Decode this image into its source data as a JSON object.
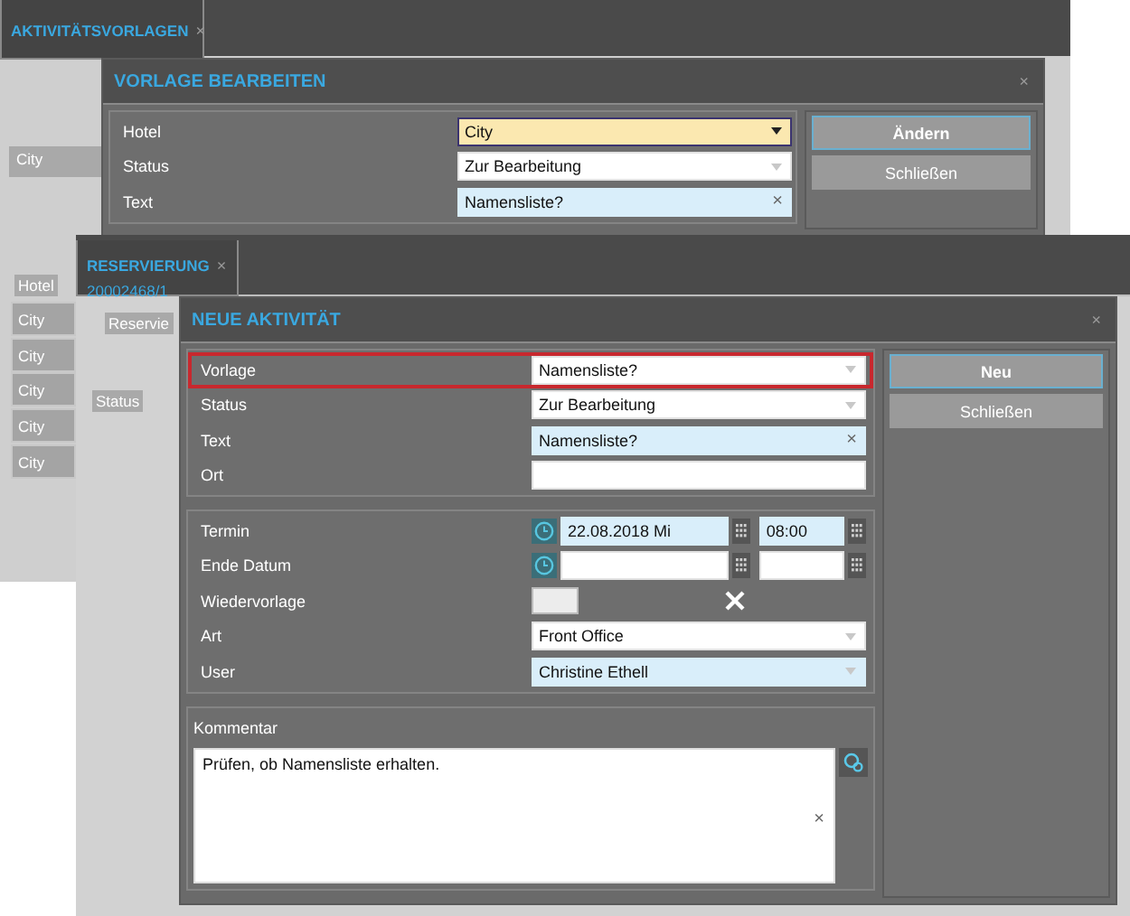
{
  "background_window": {
    "tab": {
      "label": "AKTIVITÄTSVORLAGEN",
      "close": "×"
    },
    "filter_field": {
      "value": "City"
    },
    "table": {
      "columns": [
        "Hotel"
      ],
      "rows": [
        "City",
        "City",
        "City",
        "City",
        "City"
      ]
    }
  },
  "edit_dialog": {
    "title": "VORLAGE BEARBEITEN",
    "close": "×",
    "fields": [
      {
        "label": "Hotel",
        "kind": "dropdown",
        "value": "City",
        "focused": true,
        "required": false
      },
      {
        "label": "Status",
        "kind": "dropdown",
        "value": "Zur Bearbeitung",
        "focused": false,
        "required": false
      },
      {
        "label": "Text",
        "kind": "text",
        "value": "Namensliste?",
        "clear": "×",
        "focused": false,
        "required": true
      }
    ],
    "buttons": [
      {
        "label": "Ändern",
        "primary": true
      },
      {
        "label": "Schließen",
        "primary": false
      }
    ]
  },
  "reservation_window": {
    "tab": {
      "label": "RESERVIERUNG",
      "close": "×",
      "subtitle": "20002468/1"
    },
    "inner_tab": "Reservie",
    "column": "Status"
  },
  "new_activity_dialog": {
    "title": "NEUE AKTIVITÄT",
    "close": "×",
    "sections": [
      {
        "fields": [
          {
            "label": "Vorlage",
            "kind": "dropdown",
            "value": "Namensliste?",
            "required": false,
            "error": true
          },
          {
            "label": "Status",
            "kind": "dropdown",
            "value": "Zur Bearbeitung",
            "required": false,
            "error": false
          },
          {
            "label": "Text",
            "kind": "text",
            "value": "Namensliste?",
            "clear": "×",
            "required": true,
            "error": false
          },
          {
            "label": "Ort",
            "kind": "text",
            "required": false,
            "error": false
          }
        ]
      },
      {
        "fields": [
          {
            "label": "Termin",
            "kind": "datetime",
            "date": "22.08.2018 Mi",
            "time": "08:00",
            "required": true,
            "error": false
          },
          {
            "label": "Ende Datum",
            "kind": "datetime",
            "required": false,
            "error": false
          },
          {
            "label": "Wiedervorlage",
            "kind": "toggle",
            "checked": false,
            "error": false
          },
          {
            "label": "Art",
            "kind": "dropdown",
            "value": "Front Office",
            "required": false,
            "error": false
          },
          {
            "label": "User",
            "kind": "dropdown",
            "value": "Christine Ethell",
            "required": true,
            "error": false
          }
        ]
      }
    ],
    "comment": {
      "label": "Kommentar",
      "value": "Prüfen, ob Namensliste erhalten.",
      "clear": "×"
    },
    "buttons": [
      {
        "label": "Neu",
        "primary": true
      },
      {
        "label": "Schließen",
        "primary": false
      }
    ]
  }
}
